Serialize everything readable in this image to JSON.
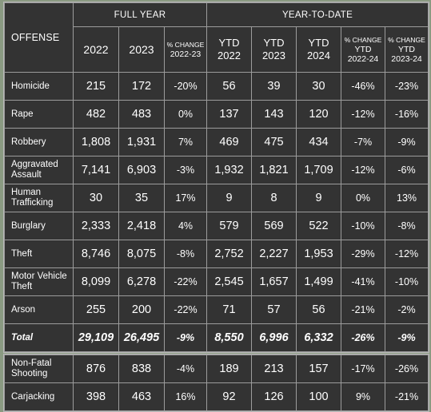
{
  "table": {
    "corner_label": "OFFENSE",
    "group_headers": [
      {
        "label": "FULL YEAR",
        "span": 3
      },
      {
        "label": "YEAR-TO-DATE",
        "span": 5
      }
    ],
    "column_headers": [
      {
        "type": "year",
        "lines": [
          "2022"
        ]
      },
      {
        "type": "year",
        "lines": [
          "2023"
        ]
      },
      {
        "type": "pct",
        "lines": [
          "% CHANGE",
          "2022-23"
        ]
      },
      {
        "type": "ytd",
        "lines": [
          "YTD",
          "2022"
        ]
      },
      {
        "type": "ytd",
        "lines": [
          "YTD",
          "2023"
        ]
      },
      {
        "type": "ytd",
        "lines": [
          "YTD",
          "2024"
        ]
      },
      {
        "type": "pct",
        "lines": [
          "% CHANGE",
          "YTD",
          "2022-24"
        ]
      },
      {
        "type": "pct",
        "lines": [
          "% CHANGE",
          "YTD",
          "2023-24"
        ]
      }
    ],
    "rows": [
      {
        "offense": "Homicide",
        "full_2022": "215",
        "full_2023": "172",
        "chg_22_23": "-20%",
        "chg_22_23_dir": "down",
        "ytd_2022": "56",
        "ytd_2023": "39",
        "ytd_2024": "30",
        "chg_ytd_22_24": "-46%",
        "chg_ytd_22_24_dir": "down",
        "chg_ytd_23_24": "-23%",
        "chg_ytd_23_24_dir": "down"
      },
      {
        "offense": "Rape",
        "full_2022": "482",
        "full_2023": "483",
        "chg_22_23": "0%",
        "chg_22_23_dir": "down",
        "ytd_2022": "137",
        "ytd_2023": "143",
        "ytd_2024": "120",
        "chg_ytd_22_24": "-12%",
        "chg_ytd_22_24_dir": "down",
        "chg_ytd_23_24": "-16%",
        "chg_ytd_23_24_dir": "down"
      },
      {
        "offense": "Robbery",
        "full_2022": "1,808",
        "full_2023": "1,931",
        "chg_22_23": "7%",
        "chg_22_23_dir": "up",
        "ytd_2022": "469",
        "ytd_2023": "475",
        "ytd_2024": "434",
        "chg_ytd_22_24": "-7%",
        "chg_ytd_22_24_dir": "down",
        "chg_ytd_23_24": "-9%",
        "chg_ytd_23_24_dir": "down"
      },
      {
        "offense": "Aggravated Assault",
        "full_2022": "7,141",
        "full_2023": "6,903",
        "chg_22_23": "-3%",
        "chg_22_23_dir": "down",
        "ytd_2022": "1,932",
        "ytd_2023": "1,821",
        "ytd_2024": "1,709",
        "chg_ytd_22_24": "-12%",
        "chg_ytd_22_24_dir": "down",
        "chg_ytd_23_24": "-6%",
        "chg_ytd_23_24_dir": "down"
      },
      {
        "offense": "Human Trafficking",
        "full_2022": "30",
        "full_2023": "35",
        "chg_22_23": "17%",
        "chg_22_23_dir": "up",
        "ytd_2022": "9",
        "ytd_2023": "8",
        "ytd_2024": "9",
        "chg_ytd_22_24": "0%",
        "chg_ytd_22_24_dir": "down",
        "chg_ytd_23_24": "13%",
        "chg_ytd_23_24_dir": "up"
      },
      {
        "offense": "Burglary",
        "full_2022": "2,333",
        "full_2023": "2,418",
        "chg_22_23": "4%",
        "chg_22_23_dir": "up",
        "ytd_2022": "579",
        "ytd_2023": "569",
        "ytd_2024": "522",
        "chg_ytd_22_24": "-10%",
        "chg_ytd_22_24_dir": "down",
        "chg_ytd_23_24": "-8%",
        "chg_ytd_23_24_dir": "down"
      },
      {
        "offense": "Theft",
        "full_2022": "8,746",
        "full_2023": "8,075",
        "chg_22_23": "-8%",
        "chg_22_23_dir": "down",
        "ytd_2022": "2,752",
        "ytd_2023": "2,227",
        "ytd_2024": "1,953",
        "chg_ytd_22_24": "-29%",
        "chg_ytd_22_24_dir": "down",
        "chg_ytd_23_24": "-12%",
        "chg_ytd_23_24_dir": "down"
      },
      {
        "offense": "Motor Vehicle Theft",
        "full_2022": "8,099",
        "full_2023": "6,278",
        "chg_22_23": "-22%",
        "chg_22_23_dir": "down",
        "ytd_2022": "2,545",
        "ytd_2023": "1,657",
        "ytd_2024": "1,499",
        "chg_ytd_22_24": "-41%",
        "chg_ytd_22_24_dir": "down",
        "chg_ytd_23_24": "-10%",
        "chg_ytd_23_24_dir": "down"
      },
      {
        "offense": "Arson",
        "full_2022": "255",
        "full_2023": "200",
        "chg_22_23": "-22%",
        "chg_22_23_dir": "down",
        "ytd_2022": "71",
        "ytd_2023": "57",
        "ytd_2024": "56",
        "chg_ytd_22_24": "-21%",
        "chg_ytd_22_24_dir": "down",
        "chg_ytd_23_24": "-2%",
        "chg_ytd_23_24_dir": "down"
      }
    ],
    "total_row": {
      "offense": "Total",
      "full_2022": "29,109",
      "full_2023": "26,495",
      "chg_22_23": "-9%",
      "chg_22_23_dir": "down",
      "ytd_2022": "8,550",
      "ytd_2023": "6,996",
      "ytd_2024": "6,332",
      "chg_ytd_22_24": "-26%",
      "chg_ytd_22_24_dir": "down",
      "chg_ytd_23_24": "-9%",
      "chg_ytd_23_24_dir": "down"
    },
    "extra_rows": [
      {
        "offense": "Non-Fatal Shooting",
        "full_2022": "876",
        "full_2023": "838",
        "chg_22_23": "-4%",
        "chg_22_23_dir": "down",
        "ytd_2022": "189",
        "ytd_2023": "213",
        "ytd_2024": "157",
        "chg_ytd_22_24": "-17%",
        "chg_ytd_22_24_dir": "down",
        "chg_ytd_23_24": "-26%",
        "chg_ytd_23_24_dir": "down"
      },
      {
        "offense": "Carjacking",
        "full_2022": "398",
        "full_2023": "463",
        "chg_22_23": "16%",
        "chg_22_23_dir": "up",
        "ytd_2022": "92",
        "ytd_2023": "126",
        "ytd_2024": "100",
        "chg_ytd_22_24": "9%",
        "chg_ytd_22_24_dir": "up",
        "chg_ytd_23_24": "-21%",
        "chg_ytd_23_24_dir": "down"
      }
    ],
    "colors": {
      "decrease": "#21a93a",
      "increase": "#ae2121",
      "cell_background": "#333333",
      "grid_line": "#9c9c9c",
      "page_background": "#8a9a82",
      "text": "#ffffff"
    }
  }
}
